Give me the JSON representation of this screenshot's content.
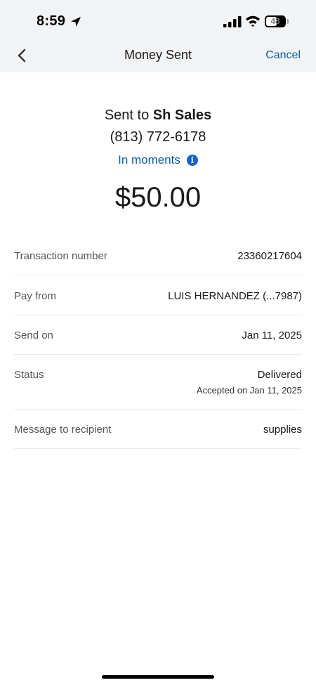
{
  "status_bar": {
    "time": "8:59",
    "battery_level": "48",
    "icons": [
      "location-arrow-icon",
      "cellular-signal-icon",
      "wifi-icon",
      "battery-icon"
    ]
  },
  "nav": {
    "back_icon": "chevron-left-icon",
    "title": "Money Sent",
    "cancel_label": "Cancel"
  },
  "summary": {
    "sent_to_prefix": "Sent to",
    "recipient_name": "Sh Sales",
    "phone": "(813) 772-6178",
    "timing": "In moments",
    "timing_icon": "info-icon",
    "amount": "$50.00"
  },
  "details": [
    {
      "label": "Transaction number",
      "value": "23360217604"
    },
    {
      "label": "Pay from",
      "value": "LUIS HERNANDEZ (...7987)"
    },
    {
      "label": "Send on",
      "value": "Jan 11, 2025"
    },
    {
      "label": "Status",
      "value": "Delivered",
      "sub": "Accepted on Jan 11, 2025"
    },
    {
      "label": "Message to recipient",
      "value": "supplies"
    }
  ],
  "colors": {
    "accent": "#0c5ea8",
    "header_bg": "#f2f3f5",
    "text": "#1a1a1a",
    "label": "#555555"
  }
}
